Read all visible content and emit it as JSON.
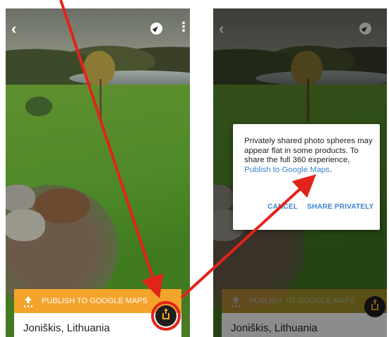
{
  "left_screen": {
    "publish_label": "PUBLISH TO GOOGLE MAPS",
    "location": "Joniškis, Lithuania"
  },
  "right_screen": {
    "publish_label": "PUBLISH TO GOOGLE MAPS",
    "location": "Joniškis, Lithuania",
    "dialog": {
      "message": "Privately shared photo spheres may appear flat in some products. To share the full 360 experience, ",
      "link": "Publish to Google Maps",
      "period": ".",
      "cancel_label": "CANCEL",
      "share_label": "SHARE PRIVATELY"
    }
  },
  "colors": {
    "accent_orange": "#f4a32b",
    "link_blue": "#3b83d3",
    "annotation_red": "#e2231a"
  },
  "icons": [
    "back-arrow-icon",
    "compass-icon",
    "more-vert-icon",
    "upload-icon",
    "share-icon"
  ]
}
